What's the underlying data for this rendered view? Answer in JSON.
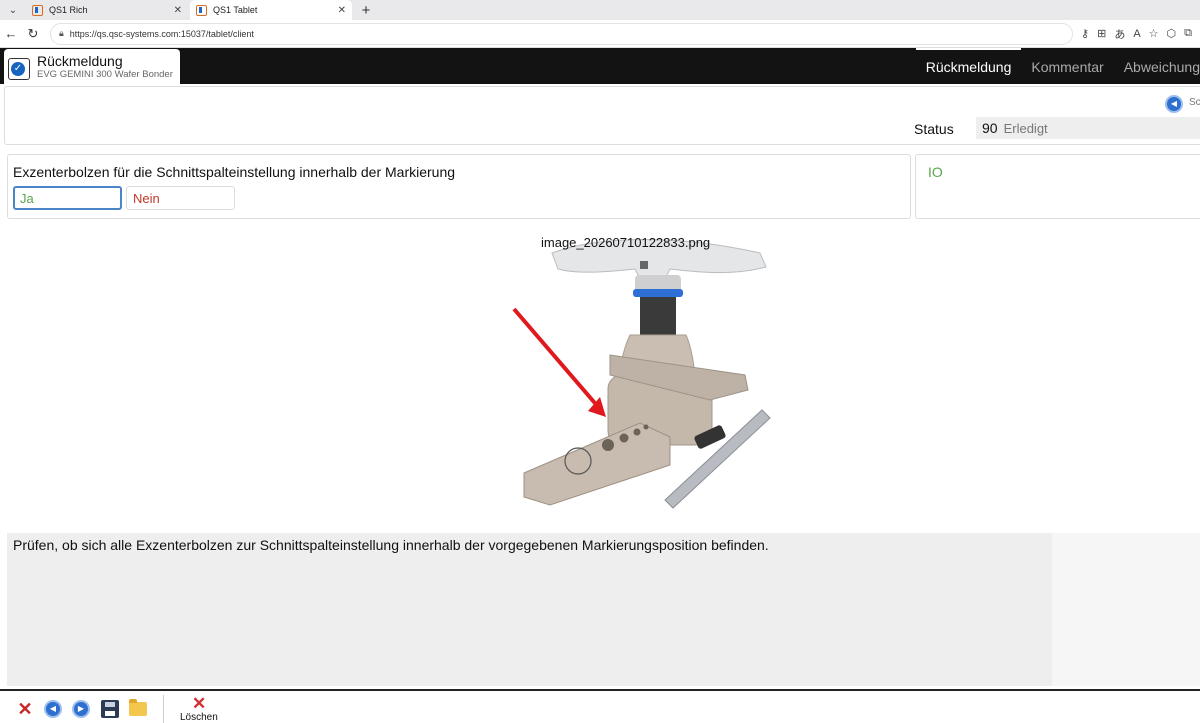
{
  "browser": {
    "tabs": [
      {
        "title": "QS1 Rich"
      },
      {
        "title": "QS1 Tablet"
      }
    ],
    "url": "https://qs.qsc-systems.com:15037/tablet/client"
  },
  "app": {
    "title": "Rückmeldung",
    "subtitle": "EVG GEMINI 300 Wafer Bonder",
    "nav": [
      "Rückmeldung",
      "Kommentar",
      "Abweichung"
    ]
  },
  "header": {
    "back_label": "Sc",
    "status_label": "Status",
    "status_code": "90",
    "status_text": "Erledigt"
  },
  "question": {
    "text": "Exzenterbolzen für die Schnittspalteinstellung innerhalb der Markierung",
    "yes": "Ja",
    "no": "Nein",
    "result": "IO"
  },
  "image": {
    "filename": "image_20260710122833.png"
  },
  "description": "Prüfen, ob sich alle Exzenterbolzen zur Schnittspalteinstellung innerhalb der vorgegebenen Markierungsposition befinden.",
  "toolbar": {
    "delete_label": "Löschen"
  }
}
